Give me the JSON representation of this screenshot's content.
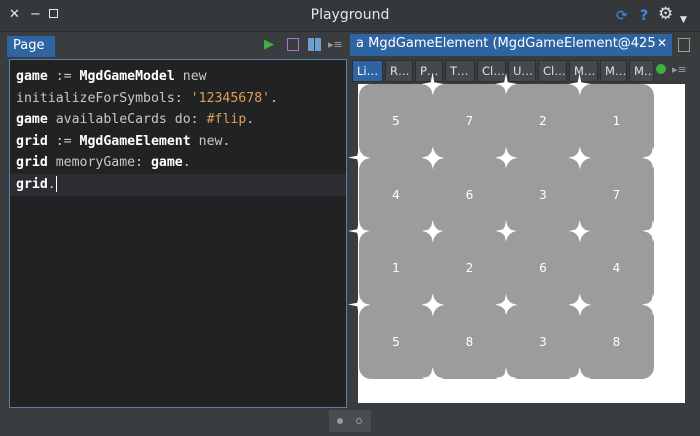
{
  "window": {
    "title": "Playground"
  },
  "left_panel": {
    "tab_label": "Page",
    "code_lines": [
      [
        {
          "t": "game",
          "c": "tok-bold"
        },
        {
          "t": " := ",
          "c": "tok-plain"
        },
        {
          "t": "MgdGameModel",
          "c": "tok-bold"
        },
        {
          "t": " new",
          "c": "tok-plain"
        }
      ],
      [
        {
          "t": "initializeForSymbols: ",
          "c": "tok-plain"
        },
        {
          "t": "'12345678'",
          "c": "tok-str"
        },
        {
          "t": ".",
          "c": "tok-plain"
        }
      ],
      [
        {
          "t": "game",
          "c": "tok-bold"
        },
        {
          "t": " availableCards do: ",
          "c": "tok-plain"
        },
        {
          "t": "#flip",
          "c": "tok-sym"
        },
        {
          "t": ".",
          "c": "tok-plain"
        }
      ],
      [
        {
          "t": "grid",
          "c": "tok-bold"
        },
        {
          "t": " := ",
          "c": "tok-plain"
        },
        {
          "t": "MgdGameElement",
          "c": "tok-bold"
        },
        {
          "t": " new.",
          "c": "tok-plain"
        }
      ],
      [
        {
          "t": "grid",
          "c": "tok-bold"
        },
        {
          "t": " memoryGame: ",
          "c": "tok-plain"
        },
        {
          "t": "game",
          "c": "tok-bold"
        },
        {
          "t": ".",
          "c": "tok-plain"
        }
      ],
      [
        {
          "t": "grid",
          "c": "tok-bold"
        },
        {
          "t": ".",
          "c": "tok-plain"
        }
      ]
    ]
  },
  "right_panel": {
    "tab_label": "a MgdGameElement (MgdGameElement@425",
    "close_label": "✕",
    "inspector_tabs": [
      "Li…",
      "R…",
      "P…",
      "T…",
      "Cl…",
      "U…",
      "Cl…",
      "M…",
      "M…",
      "M…"
    ],
    "card_rows": [
      [
        "5",
        "7",
        "2",
        "1"
      ],
      [
        "4",
        "6",
        "3",
        "7"
      ],
      [
        "1",
        "2",
        "6",
        "4"
      ],
      [
        "5",
        "8",
        "3",
        "8"
      ]
    ]
  },
  "icons": {
    "close": "close-icon",
    "minimize": "minimize-icon",
    "maximize": "maximize-icon",
    "refresh": "refresh-icon",
    "help": "help-icon",
    "settings": "gear-icon",
    "play": "play-icon",
    "save": "save-icon",
    "layout": "columns-icon",
    "menu": "menu-lines-icon"
  },
  "colors": {
    "accent": "#2f64a3",
    "card": "#9c9c9c",
    "play": "#3cb043",
    "refresh": "#3a8ee6"
  }
}
